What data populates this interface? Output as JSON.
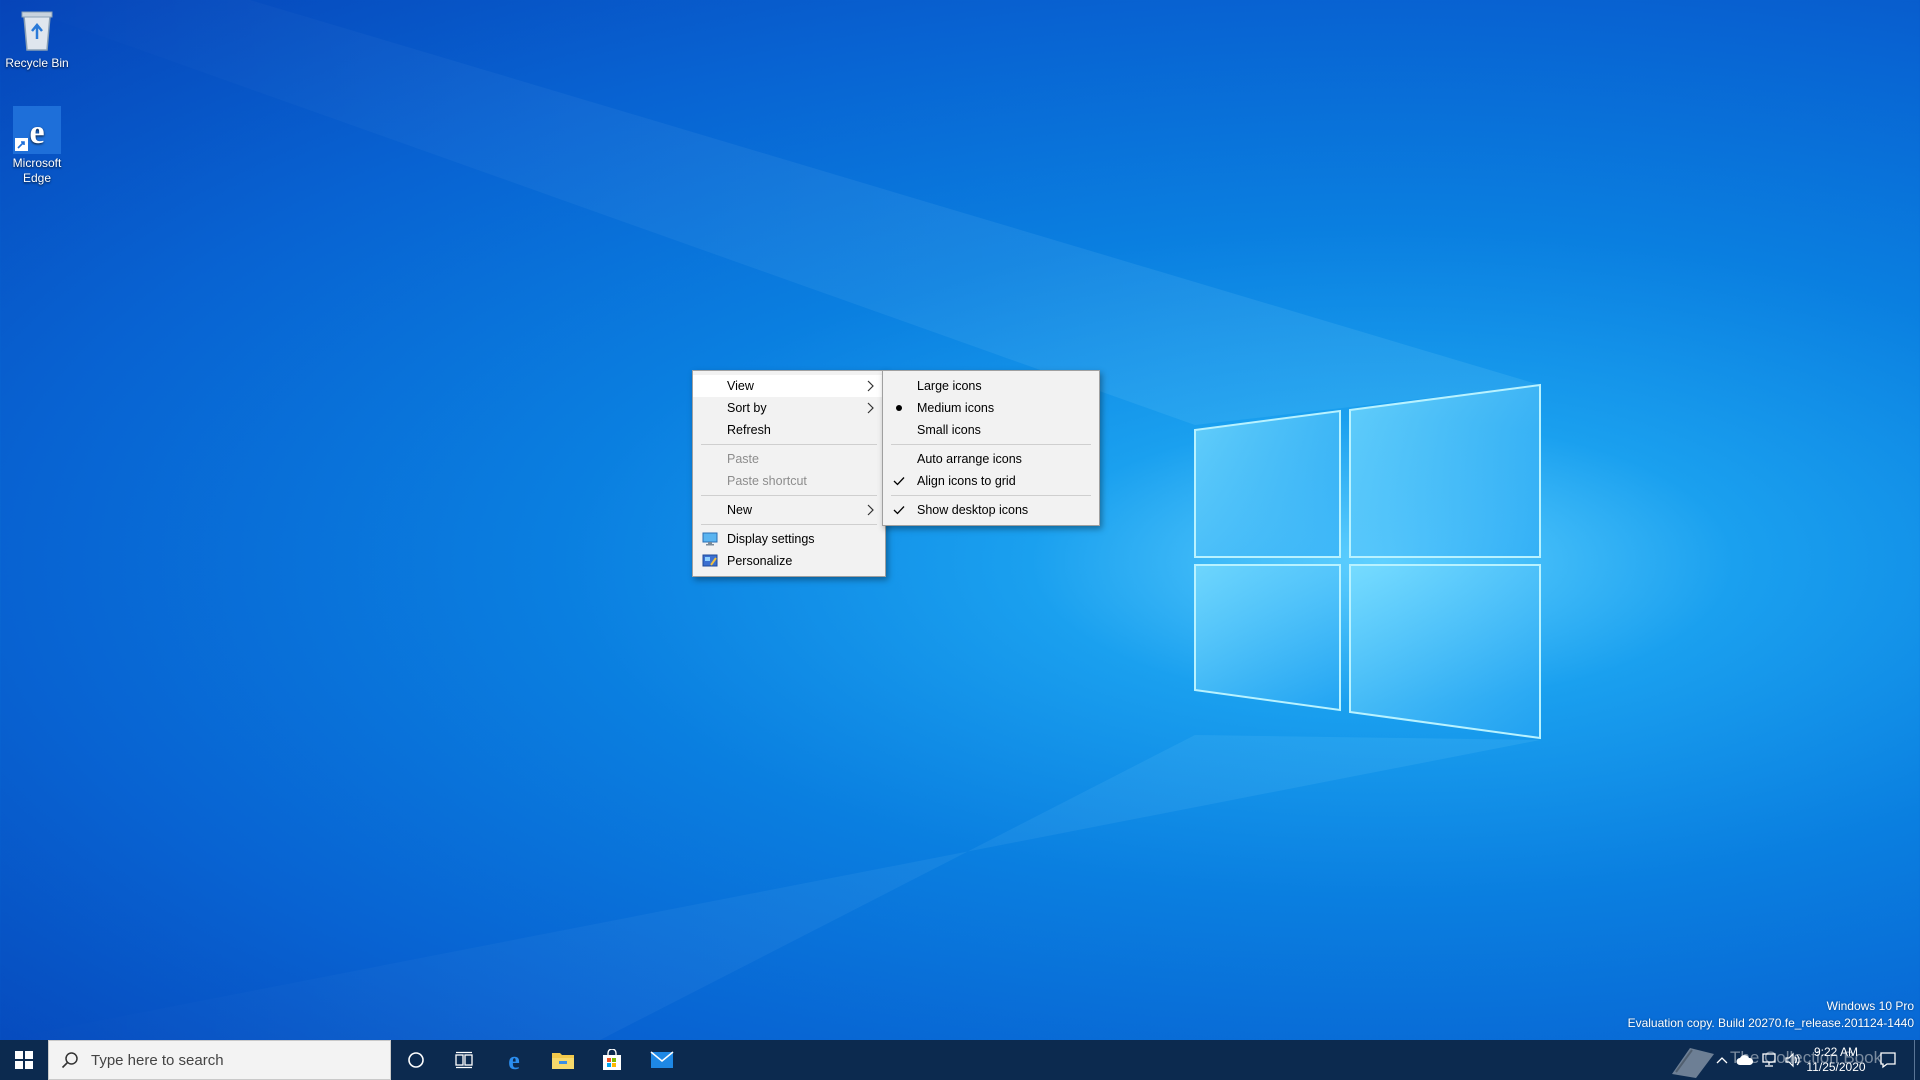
{
  "desktop": {
    "icons": [
      {
        "label": "Recycle Bin"
      },
      {
        "label": "Microsoft\nEdge"
      }
    ]
  },
  "context_menu": {
    "items": [
      {
        "label": "View",
        "submenu": true,
        "state": "hover"
      },
      {
        "label": "Sort by",
        "submenu": true
      },
      {
        "label": "Refresh"
      },
      {
        "label": "Paste",
        "disabled": true
      },
      {
        "label": "Paste shortcut",
        "disabled": true
      },
      {
        "label": "New",
        "submenu": true
      },
      {
        "label": "Display settings",
        "icon": "display-settings-icon"
      },
      {
        "label": "Personalize",
        "icon": "personalize-icon"
      }
    ]
  },
  "view_submenu": {
    "items": [
      {
        "label": "Large icons"
      },
      {
        "label": "Medium icons",
        "mark": "bullet"
      },
      {
        "label": "Small icons"
      },
      {
        "label": "Auto arrange icons"
      },
      {
        "label": "Align icons to grid",
        "mark": "check"
      },
      {
        "label": "Show desktop icons",
        "mark": "check"
      }
    ]
  },
  "watermark": {
    "line1": "Windows 10 Pro",
    "line2": "Evaluation copy. Build 20270.fe_release.201124-1440"
  },
  "taskbar": {
    "search_placeholder": "Type here to search",
    "pinned": [
      "cortana-icon",
      "task-view-icon",
      "edge-icon",
      "file-explorer-icon",
      "store-icon",
      "mail-icon"
    ],
    "clock_time": "9:22 AM",
    "clock_date": "11/25/2020",
    "overlay_watermark": "The Collection Book"
  },
  "colors": {
    "taskbar": "#0c2a4f",
    "accent": "#0078d7",
    "menu_bg": "#f2f2f2"
  }
}
